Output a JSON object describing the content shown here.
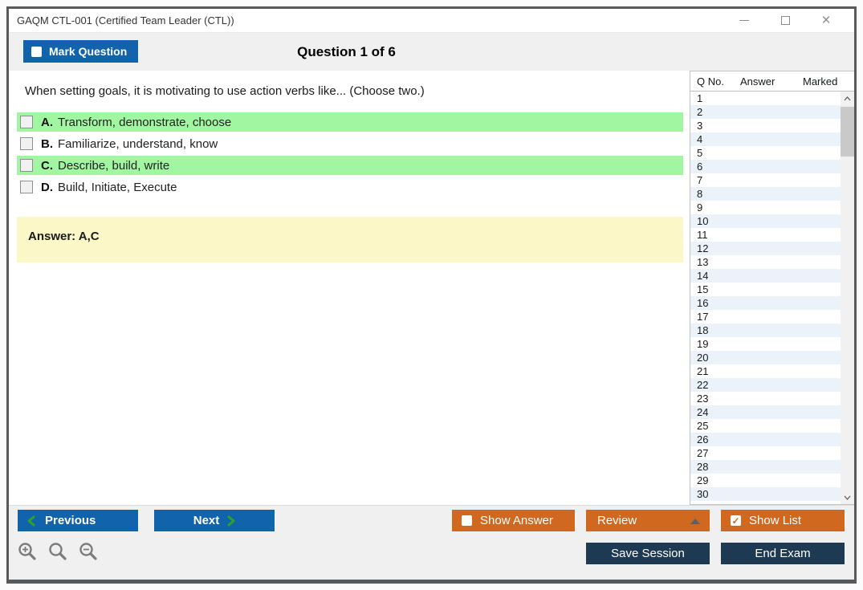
{
  "window": {
    "title": "GAQM CTL-001 (Certified Team Leader (CTL))"
  },
  "header": {
    "mark_question_label": "Mark Question",
    "question_counter": "Question 1 of 6"
  },
  "question": {
    "text": "When setting goals, it is motivating to use action verbs like... (Choose two.)",
    "options": [
      {
        "letter": "A.",
        "text": "Transform, demonstrate, choose",
        "highlighted": true,
        "checked": false
      },
      {
        "letter": "B.",
        "text": "Familiarize, understand, know",
        "highlighted": false,
        "checked": false
      },
      {
        "letter": "C.",
        "text": "Describe, build, write",
        "highlighted": true,
        "checked": false
      },
      {
        "letter": "D.",
        "text": "Build, Initiate, Execute",
        "highlighted": false,
        "checked": false
      }
    ],
    "answer_label": "Answer: A,C"
  },
  "question_list": {
    "columns": {
      "qno": "Q No.",
      "answer": "Answer",
      "marked": "Marked"
    },
    "rows": [
      "1",
      "2",
      "3",
      "4",
      "5",
      "6",
      "7",
      "8",
      "9",
      "10",
      "11",
      "12",
      "13",
      "14",
      "15",
      "16",
      "17",
      "18",
      "19",
      "20",
      "21",
      "22",
      "23",
      "24",
      "25",
      "26",
      "27",
      "28",
      "29",
      "30"
    ]
  },
  "footer": {
    "previous_label": "Previous",
    "next_label": "Next",
    "show_answer_label": "Show Answer",
    "review_label": "Review",
    "show_list_label": "Show List",
    "save_session_label": "Save Session",
    "end_exam_label": "End Exam"
  },
  "colors": {
    "accent_blue": "#1164ac",
    "accent_orange": "#d0691f",
    "dark_navy": "#1e3a52",
    "highlight_green": "#a1f7a1",
    "answer_yellow": "#fbf7c6",
    "list_alt_row": "#ebf2f9",
    "chevron_green": "#2fa12f"
  }
}
